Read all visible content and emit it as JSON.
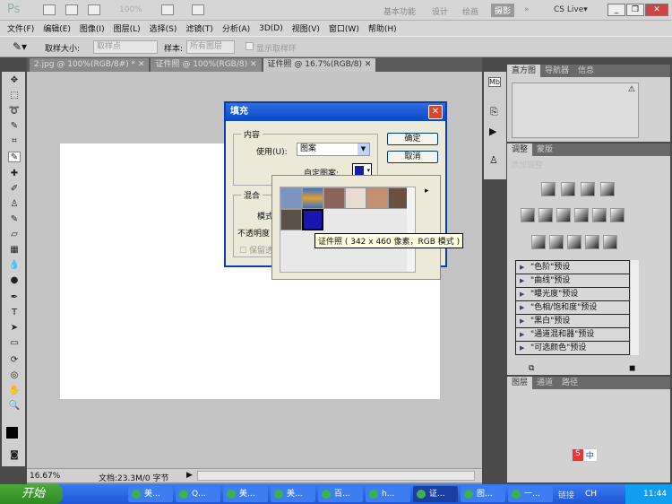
{
  "app": {
    "logo": "Ps",
    "zoom_combo": "100%",
    "workspaces": [
      "基本功能",
      "设计",
      "绘画",
      "摄影"
    ],
    "more": "»",
    "cslive": "CS Live▾",
    "win_buttons": [
      "_",
      "❐",
      "✕"
    ]
  },
  "menu": [
    "文件(F)",
    "编辑(E)",
    "图像(I)",
    "图层(L)",
    "选择(S)",
    "滤镜(T)",
    "分析(A)",
    "3D(D)",
    "视图(V)",
    "窗口(W)",
    "帮助(H)"
  ],
  "options": {
    "sample_size_label": "取样大小:",
    "sample_size_value": "取样点",
    "sample_label": "样本:",
    "sample_value": "所有图层",
    "show_ring": "显示取样环"
  },
  "doc_tabs": [
    {
      "label": "2.jpg @ 100%(RGB/8#) *",
      "close": "✕"
    },
    {
      "label": "证件照 @ 100%(RGB/8)",
      "close": "✕"
    },
    {
      "label": "证件照 @ 16.7%(RGB/8)",
      "close": "✕",
      "active": true
    }
  ],
  "status": {
    "zoom": "16.67%",
    "doc": "文档:23.3M/0 字节"
  },
  "panels": {
    "top_tabs": [
      "直方图",
      "导航器",
      "信息"
    ],
    "adj_tabs": [
      "调整",
      "蒙版"
    ],
    "adj_hint": "添加调整",
    "presets": [
      "\"色阶\"预设",
      "\"曲线\"预设",
      "\"曝光度\"预设",
      "\"色相/饱和度\"预设",
      "\"黑白\"预设",
      "\"通道混和器\"预设",
      "\"可选颜色\"预设"
    ],
    "layer_tabs": [
      "图层",
      "通道",
      "路径"
    ]
  },
  "dialog": {
    "title": "填充",
    "close": "✕",
    "content_group": "内容",
    "use_label": "使用(U):",
    "use_value": "图案",
    "custom_pattern_label": "自定图案:",
    "blend_group": "混合",
    "mode_label": "模式",
    "opacity_label": "不透明度",
    "preserve_label": "保留透",
    "ok": "确定",
    "cancel": "取消"
  },
  "pattern_tooltip": "证件照 ( 342 x 460 像素，RGB 模式 )",
  "ime": {
    "logo": "S",
    "mode": "中"
  },
  "taskbar": {
    "start": "开始",
    "tasks": [
      "美...",
      "Q...",
      "美...",
      "美...",
      "百...",
      "h...",
      "证...",
      "图...",
      "一..."
    ],
    "tray": [
      "链接",
      "CH"
    ],
    "clock": "11:44"
  },
  "colors": {
    "accent": "#0a48c8",
    "ps_bg": "#c3c3c3",
    "taskbar": "#1f57d6"
  }
}
